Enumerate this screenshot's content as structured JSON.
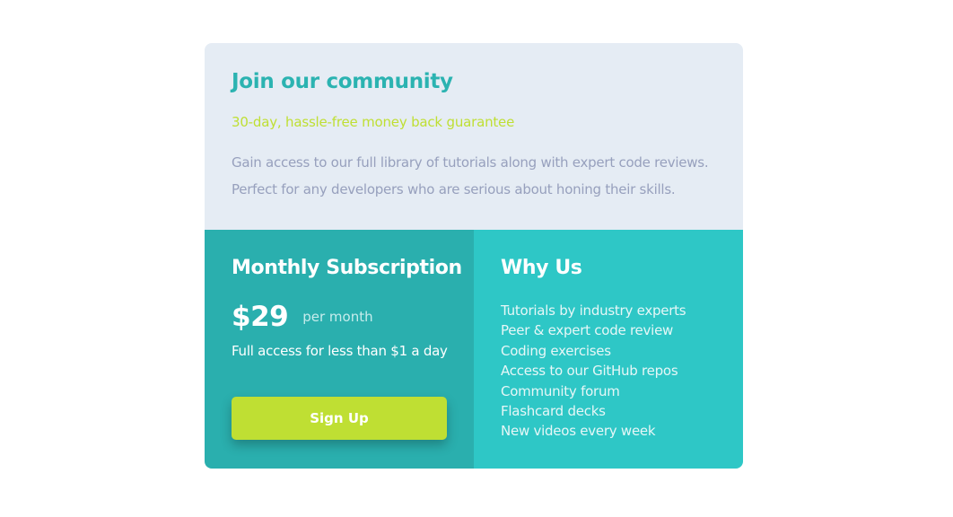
{
  "community": {
    "title": "Join our community",
    "guarantee": "30-day, hassle-free money back guarantee",
    "description_lines": [
      "Gain access to our full library of tutorials along with expert code reviews.",
      "Perfect for any developers who are serious about honing their skills."
    ]
  },
  "subscription": {
    "title": "Monthly Subscription",
    "price": "$29",
    "period": "per month",
    "tagline": "Full access for less than $1 a day",
    "button_label": "Sign Up"
  },
  "why": {
    "title": "Why Us",
    "features": [
      "Tutorials by industry experts",
      "Peer & expert code review",
      "Coding exercises",
      "Access to our GitHub repos",
      "Community forum",
      "Flashcard decks",
      "New videos every week"
    ]
  },
  "colors": {
    "accent_cyan": "#2bb3b1",
    "accent_lime": "#bfdf33",
    "top_background": "#e5ecf4",
    "subscription_background": "#2aafae",
    "why_background": "#2ec7c6",
    "description_text": "#97a0bd"
  }
}
